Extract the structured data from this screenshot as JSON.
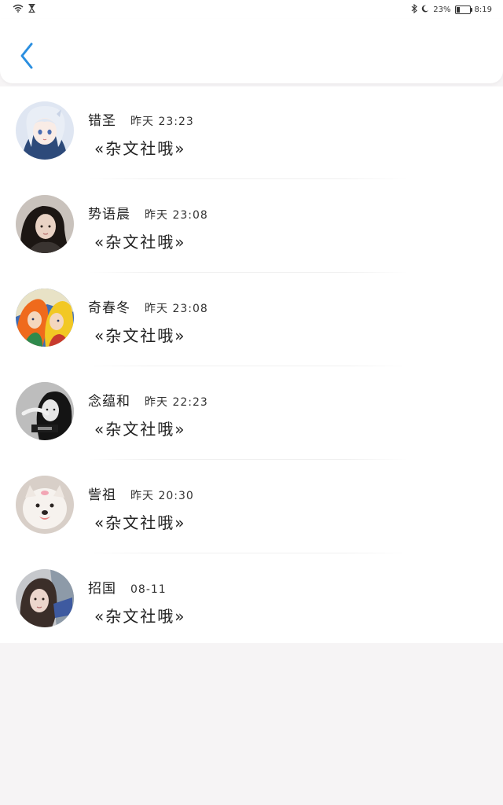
{
  "status_bar": {
    "battery_percent_label": "23%",
    "battery_level": 0.23,
    "time": "8:19",
    "icons": [
      "wifi-icon",
      "hourglass-icon",
      "bluetooth-icon",
      "moon-icon",
      "battery-icon"
    ]
  },
  "header": {
    "back_icon": "chevron-left-icon",
    "accent_color": "#2b8fe0"
  },
  "conversations": [
    {
      "name": "错圣",
      "time": "昨天 23:23",
      "message": "«杂文社哦»",
      "avatar": "anime-girl-white-hair"
    },
    {
      "name": "势语晨",
      "time": "昨天 23:08",
      "message": "«杂文社哦»",
      "avatar": "girl-dark-hair"
    },
    {
      "name": "奇春冬",
      "time": "昨天 23:08",
      "message": "«杂文社哦»",
      "avatar": "anime-orange-hair"
    },
    {
      "name": "念蕴和",
      "time": "昨天 22:23",
      "message": "«杂文社哦»",
      "avatar": "girl-black-white"
    },
    {
      "name": "訾祖",
      "time": "昨天 20:30",
      "message": "«杂文社哦»",
      "avatar": "white-dog"
    },
    {
      "name": "招国",
      "time": "08-11",
      "message": "«杂文社哦»",
      "avatar": "girl-selfie"
    }
  ],
  "colors": {
    "page_background": "#f6f4f5",
    "panel_background": "#ffffff",
    "text": "#222222"
  }
}
